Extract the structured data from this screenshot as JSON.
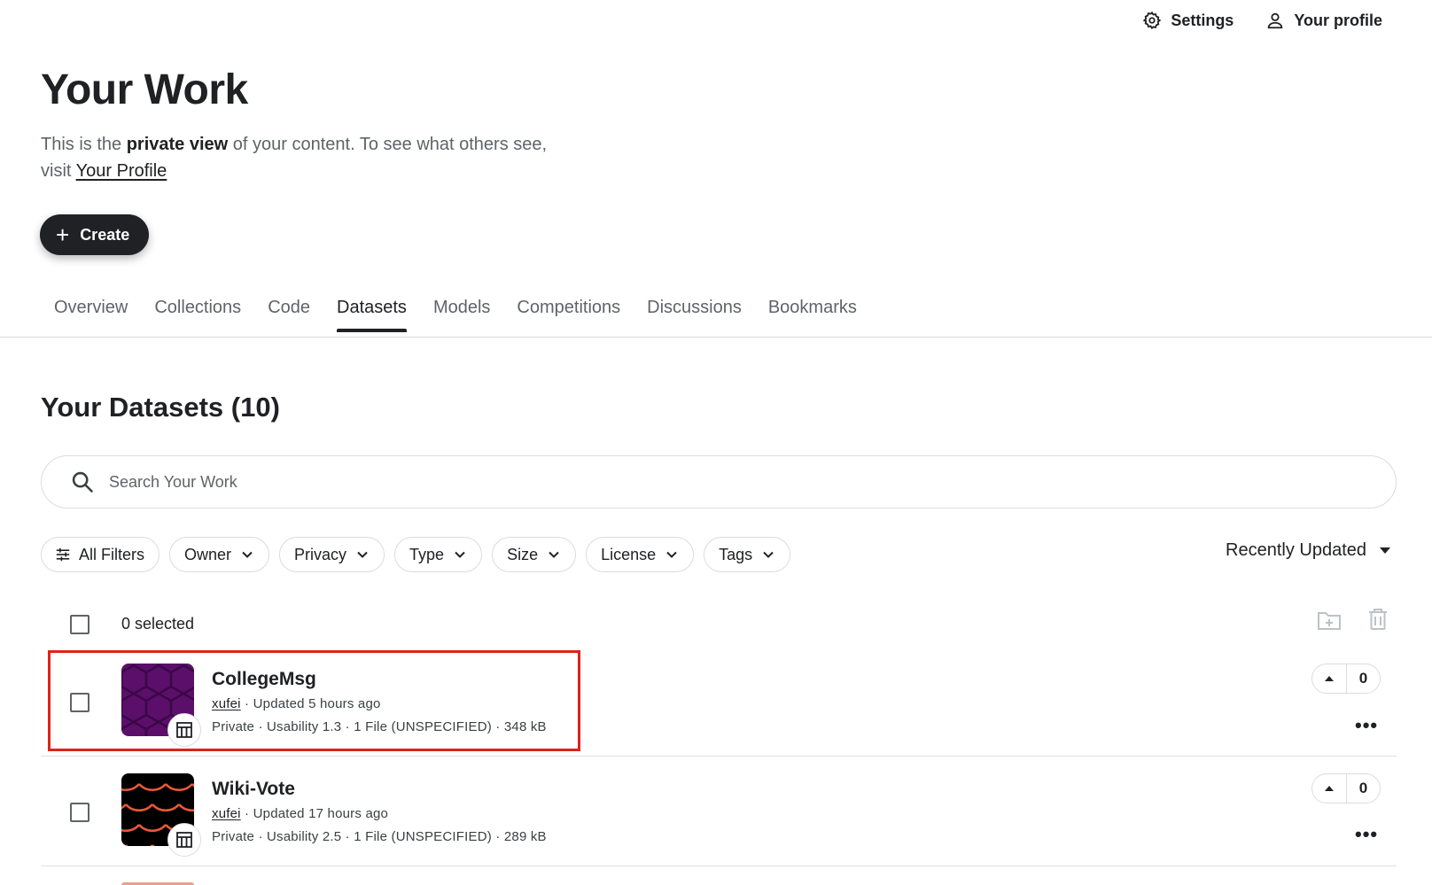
{
  "topnav": {
    "settings": "Settings",
    "profile": "Your profile"
  },
  "page": {
    "title": "Your Work",
    "intro_pre": "This is the ",
    "intro_bold": "private view",
    "intro_mid": " of your content. To see what others see, visit ",
    "intro_link": "Your Profile",
    "create_label": "Create"
  },
  "tabs": [
    "Overview",
    "Collections",
    "Code",
    "Datasets",
    "Models",
    "Competitions",
    "Discussions",
    "Bookmarks"
  ],
  "active_tab": "Datasets",
  "datasets": {
    "title": "Your Datasets (10)",
    "search_placeholder": "Search Your Work",
    "filters": [
      "All Filters",
      "Owner",
      "Privacy",
      "Type",
      "Size",
      "License",
      "Tags"
    ],
    "sort_label": "Recently Updated",
    "selected_text": "0 selected",
    "items": [
      {
        "title": "CollegeMsg",
        "owner": "xufei",
        "updated": " · Updated 5 hours ago",
        "details": "Private · Usability 1.3 · 1 File (UNSPECIFIED) · 348 kB",
        "votes": "0",
        "thumb_color": "#5b0f6b"
      },
      {
        "title": "Wiki-Vote",
        "owner": "xufei",
        "updated": " · Updated 17 hours ago",
        "details": "Private · Usability 2.5 · 1 File (UNSPECIFIED) · 289 kB",
        "votes": "0",
        "thumb_color": "#000000"
      }
    ]
  },
  "colors": {
    "accent": "#202124",
    "highlight": "#e0211b",
    "muted": "#5f6368"
  }
}
